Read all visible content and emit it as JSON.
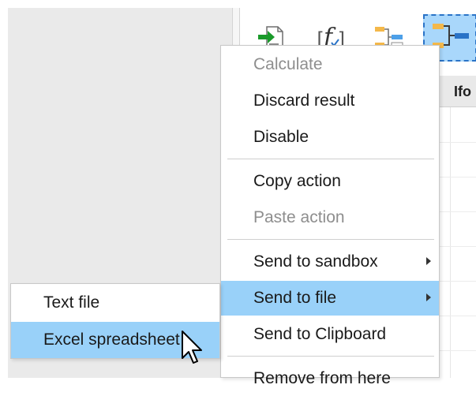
{
  "table": {
    "column_header": "Ifo"
  },
  "toolbar": {
    "icons": [
      "import-document-icon",
      "function-icon",
      "flow-diagram-icon",
      "flow-diagram-selected-icon"
    ],
    "function_glyph": "f",
    "function_brackets_left": "[",
    "function_brackets_right": "]"
  },
  "context_menu": {
    "items": [
      {
        "label": "Calculate",
        "disabled": true
      },
      {
        "label": "Discard result",
        "disabled": false
      },
      {
        "label": "Disable",
        "disabled": false
      },
      {
        "label": "Copy action",
        "disabled": false
      },
      {
        "label": "Paste action",
        "disabled": true
      },
      {
        "label": "Send to sandbox",
        "disabled": false,
        "submenu": true
      },
      {
        "label": "Send to file",
        "disabled": false,
        "submenu": true,
        "highlighted": true
      },
      {
        "label": "Send to Clipboard",
        "disabled": false
      },
      {
        "label": "Remove from here",
        "disabled": false
      }
    ]
  },
  "submenu": {
    "items": [
      {
        "label": "Text file"
      },
      {
        "label": "Excel spreadsheet",
        "highlighted": true
      }
    ]
  },
  "colors": {
    "highlight": "#99d1f9",
    "disabled_text": "#8e8e8e",
    "panel_bg": "#eaeaea"
  }
}
